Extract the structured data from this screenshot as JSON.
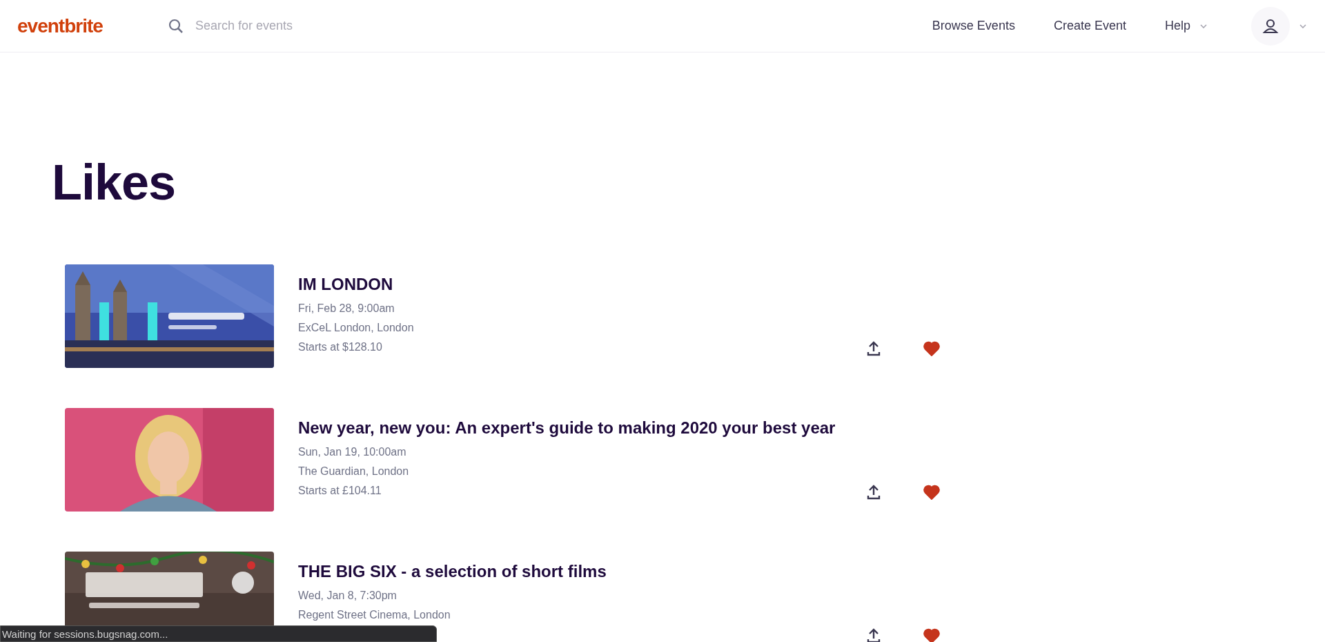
{
  "header": {
    "logo": "eventbrite",
    "search": {
      "placeholder": "Search for events"
    },
    "nav": [
      {
        "label": "Browse Events",
        "kind": "link"
      },
      {
        "label": "Create Event",
        "kind": "link"
      },
      {
        "label": "Help",
        "kind": "dropdown"
      }
    ]
  },
  "page_title": "Likes",
  "events": [
    {
      "title": "IM LONDON",
      "date": "Fri, Feb 28, 9:00am",
      "venue": "ExCeL London, London",
      "price": "Starts at $128.10",
      "liked": true
    },
    {
      "title": "New year, new you: An expert's guide to making 2020 your best year",
      "date": "Sun, Jan 19, 10:00am",
      "venue": "The Guardian, London",
      "price": "Starts at £104.11",
      "liked": true
    },
    {
      "title": "THE BIG SIX - a selection of short films",
      "date": "Wed, Jan 8, 7:30pm",
      "venue": "Regent Street Cinema, London",
      "liked": true
    }
  ],
  "status_bar": "Waiting for sessions.bugsnag.com..."
}
